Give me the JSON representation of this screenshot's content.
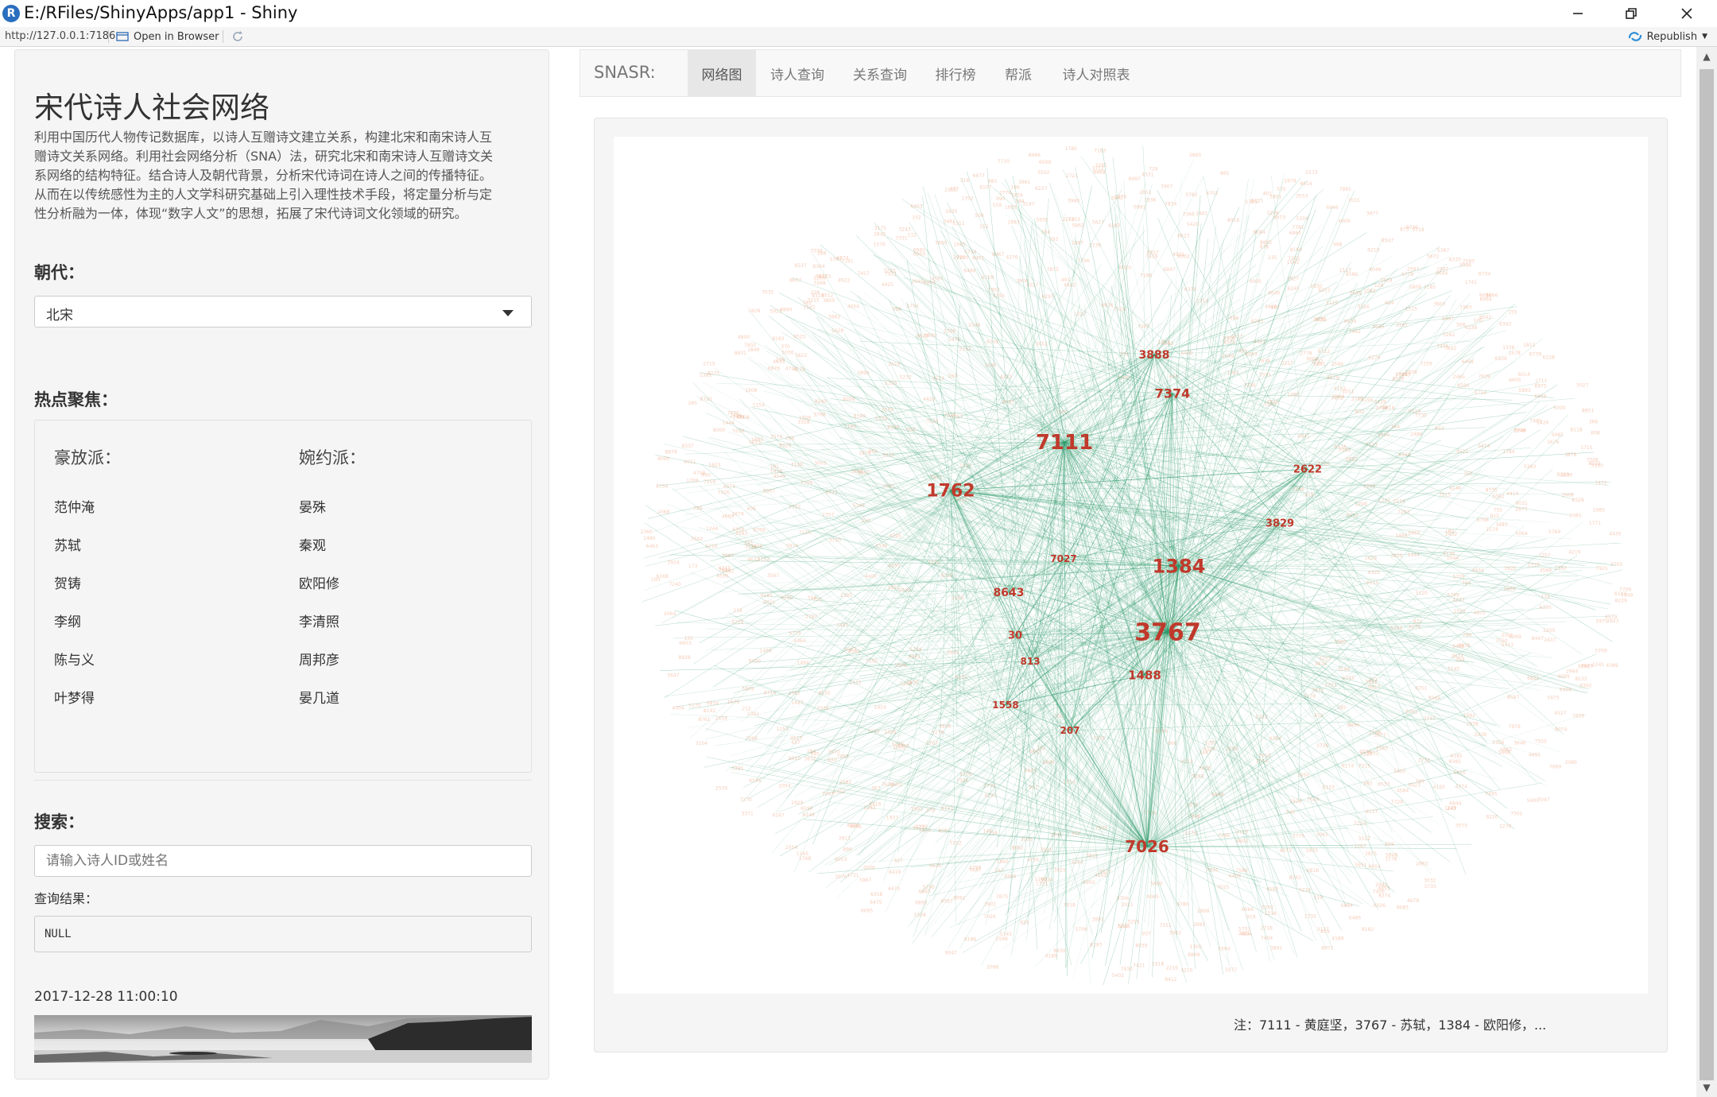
{
  "window": {
    "title": "E:/RFiles/ShinyApps/app1 - Shiny",
    "url": "http://127.0.0.1:7186",
    "open_in_browser": "Open in Browser",
    "republish": "Republish"
  },
  "sidebar": {
    "title": "宋代诗人社会网络",
    "description_lines": [
      "利用中国历代人物传记数据库，以诗人互赠诗文建立关系，构建北宋和南宋诗人互",
      "赠诗文关系网络。利用社会网络分析（SNA）法，研究北宋和南宋诗人互赠诗文关",
      "系网络的结构特征。结合诗人及朝代背景，分析宋代诗词在诗人之间的传播特征。",
      "从而在以传统感性为主的人文学科研究基础上引入理性技术手段，将定量分析与定",
      "性分析融为一体，体现“数字人文”的思想，拓展了宋代诗词文化领域的研究。"
    ],
    "dynasty_label": "朝代：",
    "dynasty_selected": "北宋",
    "hot_label": "热点聚焦：",
    "haofang": {
      "heading": "豪放派：",
      "poets": [
        "范仲淹",
        "苏轼",
        "贺铸",
        "李纲",
        "陈与义",
        "叶梦得"
      ]
    },
    "wanyue": {
      "heading": "婉约派：",
      "poets": [
        "晏殊",
        "秦观",
        "欧阳修",
        "李清照",
        "周邦彦",
        "晏几道"
      ]
    },
    "search_label": "搜索：",
    "search_placeholder": "请输入诗人ID或姓名",
    "result_label": "查询结果：",
    "result_value": "NULL",
    "timestamp": "2017-12-28 11:00:10"
  },
  "nav": {
    "brand": "SNASR:",
    "tabs": [
      "网络图",
      "诗人查询",
      "关系查询",
      "排行榜",
      "帮派",
      "诗人对照表"
    ],
    "active_tab": "网络图"
  },
  "graph": {
    "hubs": [
      {
        "label": "7111"
      },
      {
        "label": "3767"
      },
      {
        "label": "1384"
      },
      {
        "label": "1762"
      },
      {
        "label": "7026"
      },
      {
        "label": "3888"
      },
      {
        "label": "7374"
      },
      {
        "label": "1488"
      },
      {
        "label": "8643"
      },
      {
        "label": "2622"
      },
      {
        "label": "3829"
      },
      {
        "label": "30"
      },
      {
        "label": "813"
      },
      {
        "label": "207"
      },
      {
        "label": "1558"
      },
      {
        "label": "7027"
      }
    ],
    "note": "注：7111 - 黄庭坚，3767 - 苏轼，1384 - 欧阳修，..."
  },
  "colors": {
    "edge": "#2e9a6a",
    "hub_label": "#c0392b",
    "peripheral_label": "#f2b79b"
  }
}
